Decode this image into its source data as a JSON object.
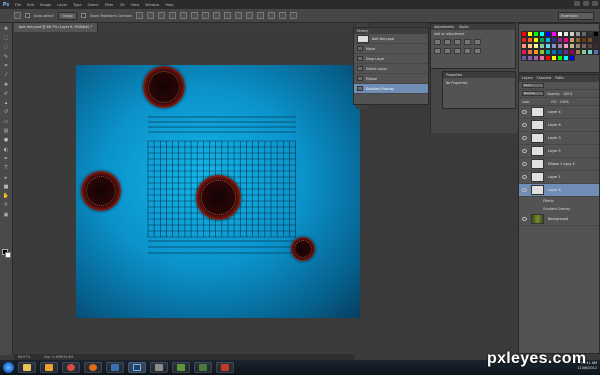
{
  "app": {
    "name": "Ps",
    "menu": [
      "File",
      "Edit",
      "Image",
      "Layer",
      "Type",
      "Select",
      "Filter",
      "3D",
      "View",
      "Window",
      "Help"
    ]
  },
  "options": {
    "auto_select_label": "Auto-select:",
    "auto_select_value": "Group",
    "show_transform_label": "Show Transform Controls",
    "workspace": "Essentials"
  },
  "document": {
    "tab_label": "bolt-fairy.psd @ 66.7% (Layer 8, RGB/8#) *",
    "zoom": "66.67%",
    "doc_size": "Doc: 5.49M/54.6M"
  },
  "history": {
    "title": "History",
    "snapshot": "bolt-fairy.psd",
    "items": [
      {
        "label": "Move",
        "active": false
      },
      {
        "label": "Drop Layer",
        "active": false
      },
      {
        "label": "Select Layer",
        "active": false
      },
      {
        "label": "Ellipse",
        "active": false
      },
      {
        "label": "Enabled Overlay",
        "active": true
      }
    ]
  },
  "adjustments": {
    "tabs": [
      "Adjustments",
      "Styles"
    ],
    "hint": "Add an adjustment"
  },
  "properties": {
    "title": "Properties",
    "text": "No Properties"
  },
  "layers": {
    "tabs": [
      "Layers",
      "Channels",
      "Paths"
    ],
    "kind": "Kind",
    "blend": "Normal",
    "opacity_label": "Opacity:",
    "opacity": "100%",
    "lock_label": "Lock:",
    "fill_label": "Fill:",
    "fill": "100%",
    "rows": [
      {
        "name": "Layer 4",
        "active": false
      },
      {
        "name": "Layer 6",
        "active": false
      },
      {
        "name": "Layer 3",
        "active": false
      },
      {
        "name": "Layer 5",
        "active": false
      },
      {
        "name": "Ellipse 1 copy 4",
        "active": false
      },
      {
        "name": "Layer 1",
        "active": false
      },
      {
        "name": "Layer 8",
        "active": true
      }
    ],
    "effects_label": "Effects",
    "effect_item": "Gradient Overlay",
    "background": "Background"
  },
  "taskbar": {
    "time": "11:41 AM",
    "date": "11/06/2012"
  },
  "watermark": "pxleyes.com",
  "colors": {
    "canvas_center": "#12b6ea",
    "canvas_edge": "#053f60",
    "selection": "#6f8db5",
    "panel": "#535353"
  },
  "swatches": [
    "#ff0000",
    "#ffff00",
    "#00ff00",
    "#00ffff",
    "#0000ff",
    "#ff00ff",
    "#ffffff",
    "#e6e6e6",
    "#cccccc",
    "#999999",
    "#666666",
    "#333333",
    "#000000",
    "#ee1c24",
    "#f26522",
    "#fff200",
    "#00a651",
    "#00aeef",
    "#2e3192",
    "#92278f",
    "#ec008c",
    "#c69c6d",
    "#8c6239",
    "#603913",
    "#754c24",
    "#3c2415",
    "#f7977a",
    "#fdc68a",
    "#fff79a",
    "#82ca9c",
    "#6dcff6",
    "#8493ca",
    "#a186be",
    "#f49ac1",
    "#c7b299",
    "#998675",
    "#736357",
    "#534741",
    "#362f2d",
    "#ed145b",
    "#f26c4f",
    "#f7941d",
    "#8dc63f",
    "#00a99d",
    "#0072bc",
    "#0054a6",
    "#662d91",
    "#9e005d",
    "#a67c52",
    "#82ca9c",
    "#7accc8",
    "#5674b9",
    "#605ca8",
    "#855fa8",
    "#a864a8",
    "#f06eaa",
    "#ff0000",
    "#ffff00",
    "#00ff00",
    "#00ffff",
    "#0000ff"
  ]
}
